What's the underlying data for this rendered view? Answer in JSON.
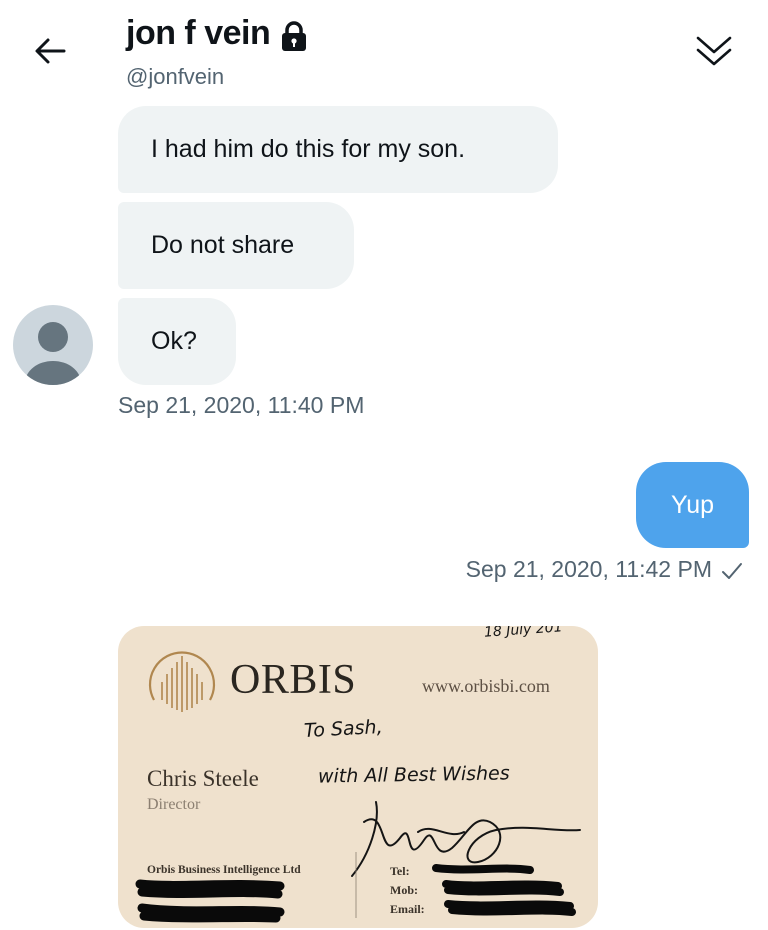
{
  "header": {
    "title": "jon f vein",
    "handle": "@jonfvein",
    "back_icon": "arrow-left-icon",
    "lock_icon": "lock-icon",
    "collapse_icon": "double-chevron-down-icon"
  },
  "messages": {
    "received": [
      "I had him do this for my son.",
      "Do not share",
      "Ok?"
    ],
    "received_timestamp": "Sep 21, 2020, 11:40 PM",
    "sent": "Yup",
    "sent_timestamp": "Sep 21, 2020, 11:42 PM",
    "sent_status_icon": "checkmark-icon"
  },
  "card": {
    "brand": "ORBIS",
    "website": "www.orbisbi.com",
    "name": "Chris Steele",
    "role": "Director",
    "company": "Orbis Business Intelligence Ltd",
    "tel_label": "Tel:",
    "mob_label": "Mob:",
    "email_label": "Email:",
    "handwritten_date": "18 July 201",
    "handwritten_to": "To Sash,",
    "handwritten_wishes": "with All Best Wishes"
  },
  "colors": {
    "sent_bubble": "#4ea3ec",
    "received_bubble": "#eff3f4",
    "muted_text": "#536471",
    "card_background": "#efe1cd"
  }
}
